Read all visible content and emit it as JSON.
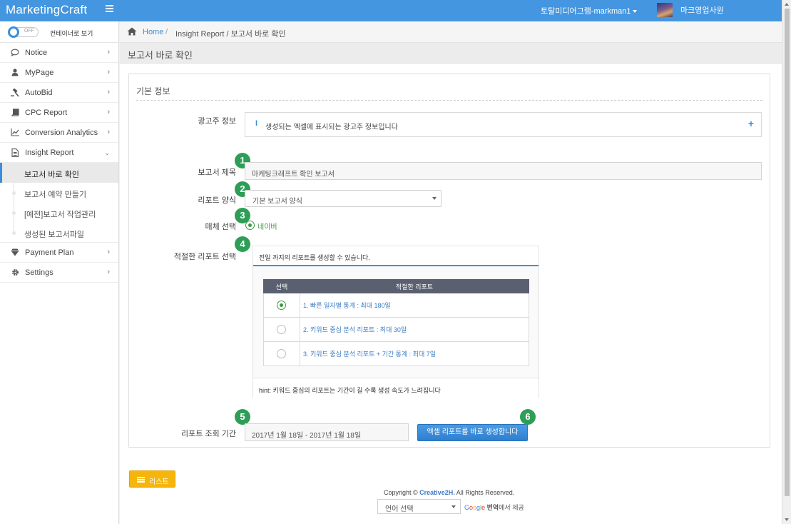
{
  "header": {
    "brand": "MarketingCraft",
    "company": "토탈미디어그램-markman1",
    "username": "마크영업사원"
  },
  "sidebar": {
    "toggle_state": "OFF",
    "toggle_label": "컨테이너로 보기",
    "items": [
      {
        "label": "Notice",
        "icon": "comment-icon"
      },
      {
        "label": "MyPage",
        "icon": "user-icon"
      },
      {
        "label": "AutoBid",
        "icon": "gavel-icon"
      },
      {
        "label": "CPC Report",
        "icon": "book-icon"
      },
      {
        "label": "Conversion Analytics",
        "icon": "line-chart-icon"
      },
      {
        "label": "Insight Report",
        "icon": "file-text-icon"
      }
    ],
    "sub_items": [
      {
        "label": "보고서 바로 확인"
      },
      {
        "label": "보고서 예약 만들기"
      },
      {
        "label": "[예전]보고서 작업관리"
      },
      {
        "label": "생성된 보고서파일"
      }
    ],
    "items_after": [
      {
        "label": "Payment Plan",
        "icon": "diamond-icon"
      },
      {
        "label": "Settings",
        "icon": "gear-icon"
      }
    ]
  },
  "breadcrumb": {
    "home": "Home",
    "separator": "/",
    "trail": "Insight Report / 보고서 바로 확인"
  },
  "page_title": "보고서 바로 확인",
  "form": {
    "section_title": "기본 정보",
    "advertiser_label": "광고주 정보",
    "advertiser_info": "생성되는 엑셀에 표시되는 광고주 정보입니다",
    "title_label": "보고서 제목",
    "title_value": "마케팅크래프트 확인 보고서",
    "format_label": "리포트 양식",
    "format_value": "기본 보고서 양식",
    "media_label": "매체 선택",
    "media_value": "네이버",
    "report_label": "적절한 리포트 선택",
    "report_notice": "전일 까지의 리포트를 생성할 수 있습니다.",
    "table_headers": [
      "선택",
      "적절한 리포트"
    ],
    "reports": [
      {
        "label": "1. 빠른 일자별 통계 : 최대 180일",
        "selected": true
      },
      {
        "label": "2. 키워드 중심 분석 리포트 : 최대 30일",
        "selected": false
      },
      {
        "label": "3. 키워드 중심 분석 리포트 + 기간 통계 : 최대 7일",
        "selected": false
      }
    ],
    "hint": "hint: 키워드 중심의 리포트는 기간이 길 수록 생성 속도가 느려집니다",
    "period_label": "리포트 조회 기간",
    "period_value": "2017년 1월 18일 - 2017년 1월 18일",
    "generate_button": "엑셀 리포트를 바로 생성합니다",
    "badges": [
      "1",
      "2",
      "3",
      "4",
      "5",
      "6"
    ]
  },
  "footer": {
    "list_button": "리스트",
    "copyright_prefix": "Copyright ©",
    "copyright_brand": "Creative2H.",
    "copyright_suffix": "All Rights Reserved.",
    "language_select": "언어 선택",
    "google": "Google",
    "translate_provided": "번역",
    "provided_suffix": "에서 제공"
  },
  "colors": {
    "accent": "#3c8dde",
    "badge": "#2e9e57",
    "list_button": "#f5b50a",
    "table_header": "#5a6070"
  }
}
